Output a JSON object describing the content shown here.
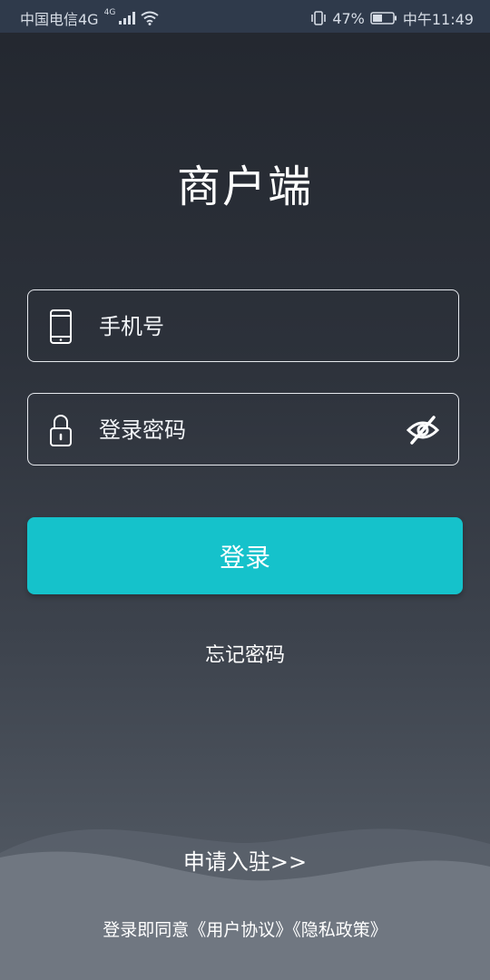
{
  "status_bar": {
    "carrier": "中国电信4G",
    "network_badge": "4G",
    "battery": "47%",
    "time": "中午11:49"
  },
  "login": {
    "title": "商户端",
    "phone_placeholder": "手机号",
    "password_placeholder": "登录密码",
    "login_button": "登录",
    "forgot_password": "忘记密码",
    "apply_link": "申请入驻>>"
  },
  "agreement": {
    "prefix": "登录即同意",
    "user_agreement": "《用户协议》",
    "privacy_policy": "《隐私政策》"
  },
  "icons": {
    "phone": "phone-icon",
    "lock": "lock-icon",
    "password_visibility": "eye-off-icon"
  },
  "colors": {
    "accent": "#15c2cb",
    "status_bar": "#2f3a4b"
  }
}
